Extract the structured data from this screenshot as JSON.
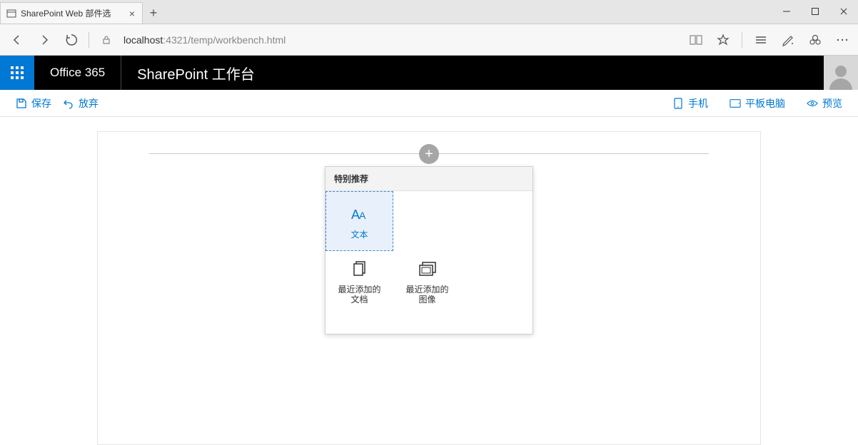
{
  "browser": {
    "tab_title": "SharePoint Web 部件​选",
    "tab_close": "×",
    "new_tab": "+",
    "url_host": "localhost",
    "url_port_path": ":4321/temp/workbench.html"
  },
  "suite": {
    "brand": "Office 365",
    "product": "SharePoint 工作台"
  },
  "commands": {
    "save": "保存",
    "discard": "放弃",
    "phone": "手机",
    "tablet": "平板电脑",
    "preview": "预览"
  },
  "toolbox": {
    "heading": "特别推荐",
    "text_label": "文本",
    "docs_label": "最近添加的\n文档",
    "images_label": "最近添加的\n图像"
  },
  "add_button": "+"
}
